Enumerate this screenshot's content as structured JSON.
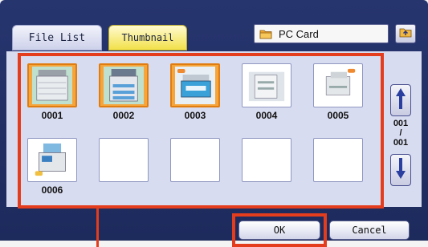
{
  "tabs": [
    {
      "label": "File List",
      "active": false
    },
    {
      "label": "Thumbnail",
      "active": true
    }
  ],
  "source": {
    "label": "PC Card",
    "icon": "folder-icon"
  },
  "up_folder_icon": "folder-up-icon",
  "thumbnails": [
    {
      "label": "0001",
      "selected": true
    },
    {
      "label": "0002",
      "selected": true
    },
    {
      "label": "0003",
      "selected": true
    },
    {
      "label": "0004",
      "selected": false
    },
    {
      "label": "0005",
      "selected": false
    },
    {
      "label": "0006",
      "selected": false
    }
  ],
  "pagination": {
    "current": "001",
    "separator": "/",
    "total": "001"
  },
  "buttons": {
    "ok": "OK",
    "cancel": "Cancel"
  },
  "colors": {
    "highlight": "#e43d1d",
    "selected": "#f6a53a",
    "panel": "#27356f"
  }
}
